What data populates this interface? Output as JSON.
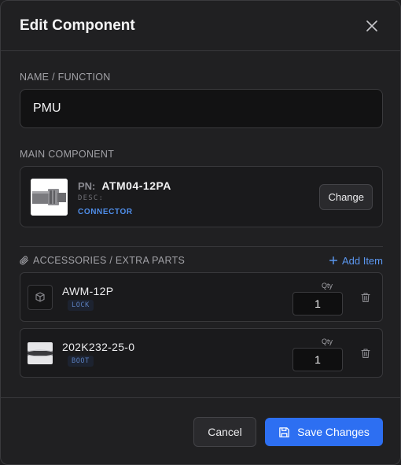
{
  "dialog": {
    "title": "Edit Component",
    "close_icon": "close-icon"
  },
  "name_field": {
    "label": "NAME / FUNCTION",
    "value": "PMU"
  },
  "main_component": {
    "label": "MAIN COMPONENT",
    "pn_key": "PN:",
    "pn": "ATM04-12PA",
    "desc_key": "DESC:",
    "type": "CONNECTOR",
    "change_label": "Change",
    "thumbnail_icon": "connector-image"
  },
  "accessories": {
    "label": "ACCESSORIES / EXTRA PARTS",
    "label_icon": "paperclip-icon",
    "add_label": "Add Item",
    "add_icon": "plus-icon",
    "qty_label": "Qty",
    "items": [
      {
        "pn": "AWM-12P",
        "tag": "LOCK",
        "qty": "1",
        "thumbnail_icon": "box-icon",
        "delete_icon": "trash-icon"
      },
      {
        "pn": "202K232-25-0",
        "tag": "BOOT",
        "qty": "1",
        "thumbnail_icon": "boot-image",
        "delete_icon": "trash-icon"
      }
    ]
  },
  "footer": {
    "cancel_label": "Cancel",
    "save_label": "Save Changes",
    "save_icon": "save-icon"
  },
  "colors": {
    "accent": "#2d6ff2",
    "link": "#5b97f0",
    "background": "#202022"
  }
}
